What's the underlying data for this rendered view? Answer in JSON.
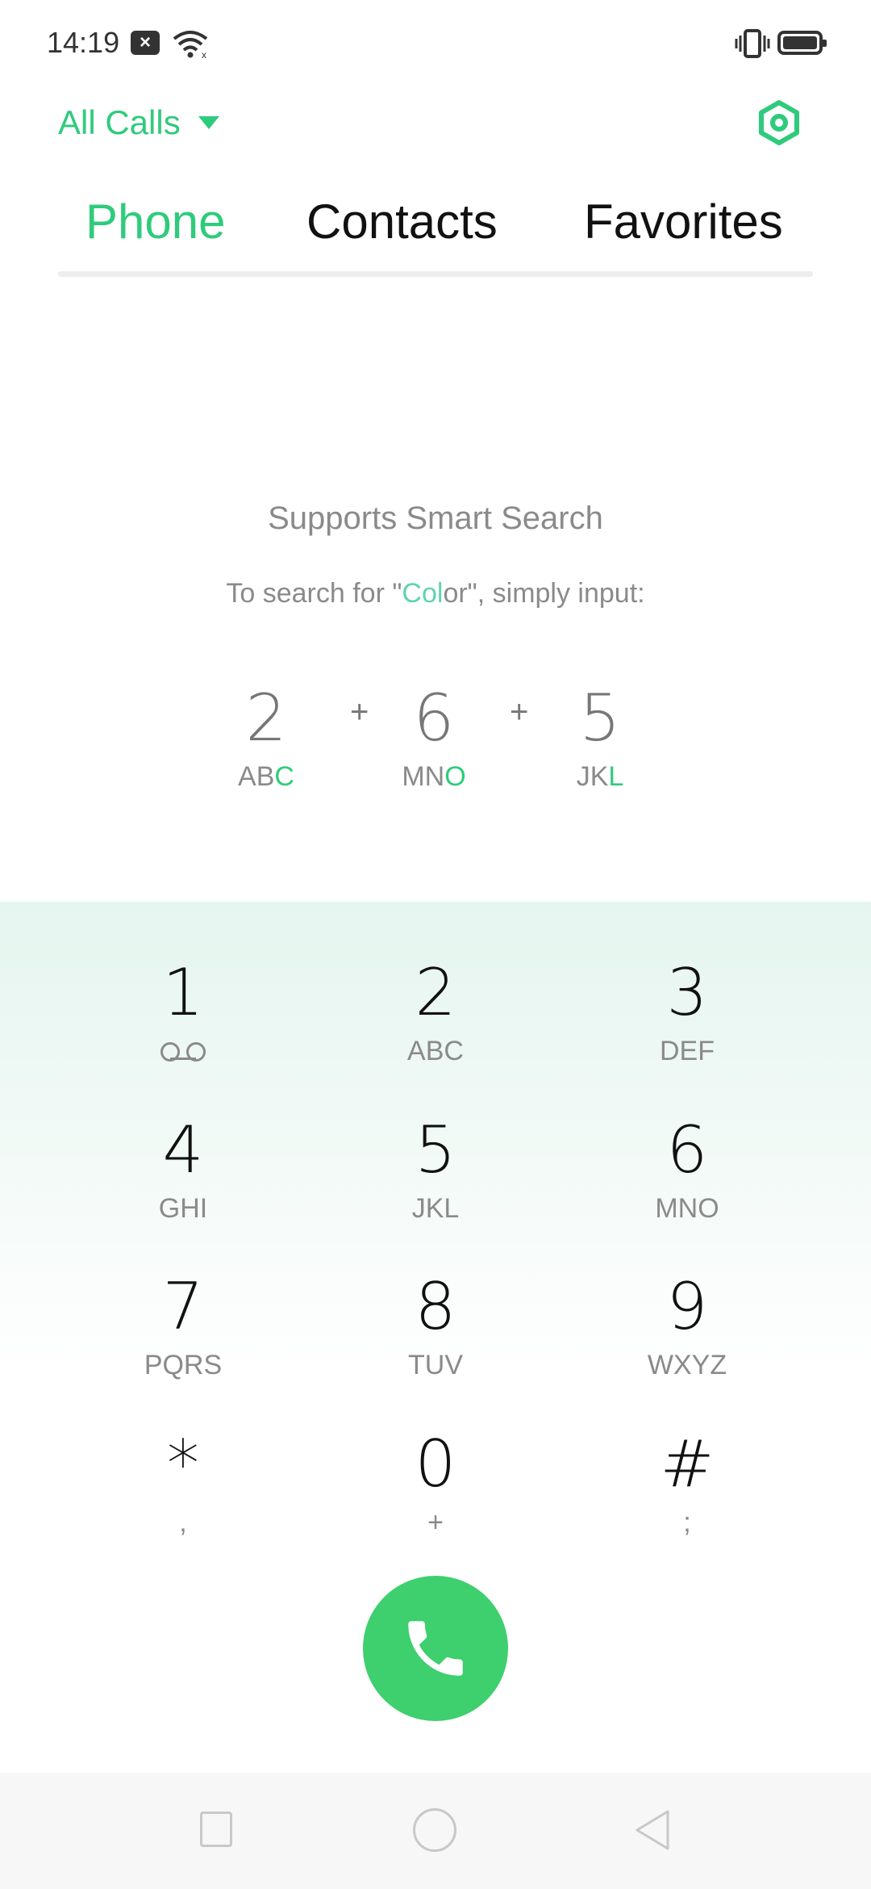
{
  "status_bar": {
    "time": "14:19",
    "notification_icon": "close-box-icon",
    "wifi_icon": "wifi-icon",
    "vibrate_icon": "vibrate-icon",
    "battery_icon": "battery-icon"
  },
  "header": {
    "filter_label": "All Calls",
    "settings_icon": "settings-hexagon-icon"
  },
  "tabs": [
    {
      "label": "Phone",
      "active": true
    },
    {
      "label": "Contacts",
      "active": false
    },
    {
      "label": "Favorites",
      "active": false
    }
  ],
  "smart_search": {
    "title": "Supports Smart Search",
    "sub_prefix": "To search for \"",
    "sub_highlight": "Col",
    "sub_suffix": "or\", simply input:",
    "example": [
      {
        "digit": "2",
        "letters": "AB",
        "letters_hl": "C"
      },
      {
        "digit": "6",
        "letters": "MN",
        "letters_hl": "O"
      },
      {
        "digit": "5",
        "letters": "JK",
        "letters_hl": "L"
      }
    ],
    "plus": "+"
  },
  "keypad": [
    {
      "digit": "1",
      "letters": ""
    },
    {
      "digit": "2",
      "letters": "ABC"
    },
    {
      "digit": "3",
      "letters": "DEF"
    },
    {
      "digit": "4",
      "letters": "GHI"
    },
    {
      "digit": "5",
      "letters": "JKL"
    },
    {
      "digit": "6",
      "letters": "MNO"
    },
    {
      "digit": "7",
      "letters": "PQRS"
    },
    {
      "digit": "8",
      "letters": "TUV"
    },
    {
      "digit": "9",
      "letters": "WXYZ"
    },
    {
      "digit": "*",
      "letters": ","
    },
    {
      "digit": "0",
      "letters": "+"
    },
    {
      "digit": "#",
      "letters": ";"
    }
  ],
  "call_button": {
    "icon": "phone-icon"
  },
  "nav_bar": {
    "recents_icon": "square-icon",
    "home_icon": "circle-icon",
    "back_icon": "triangle-back-icon"
  },
  "colors": {
    "accent": "#2fcb7c",
    "call": "#3ecf6e"
  }
}
